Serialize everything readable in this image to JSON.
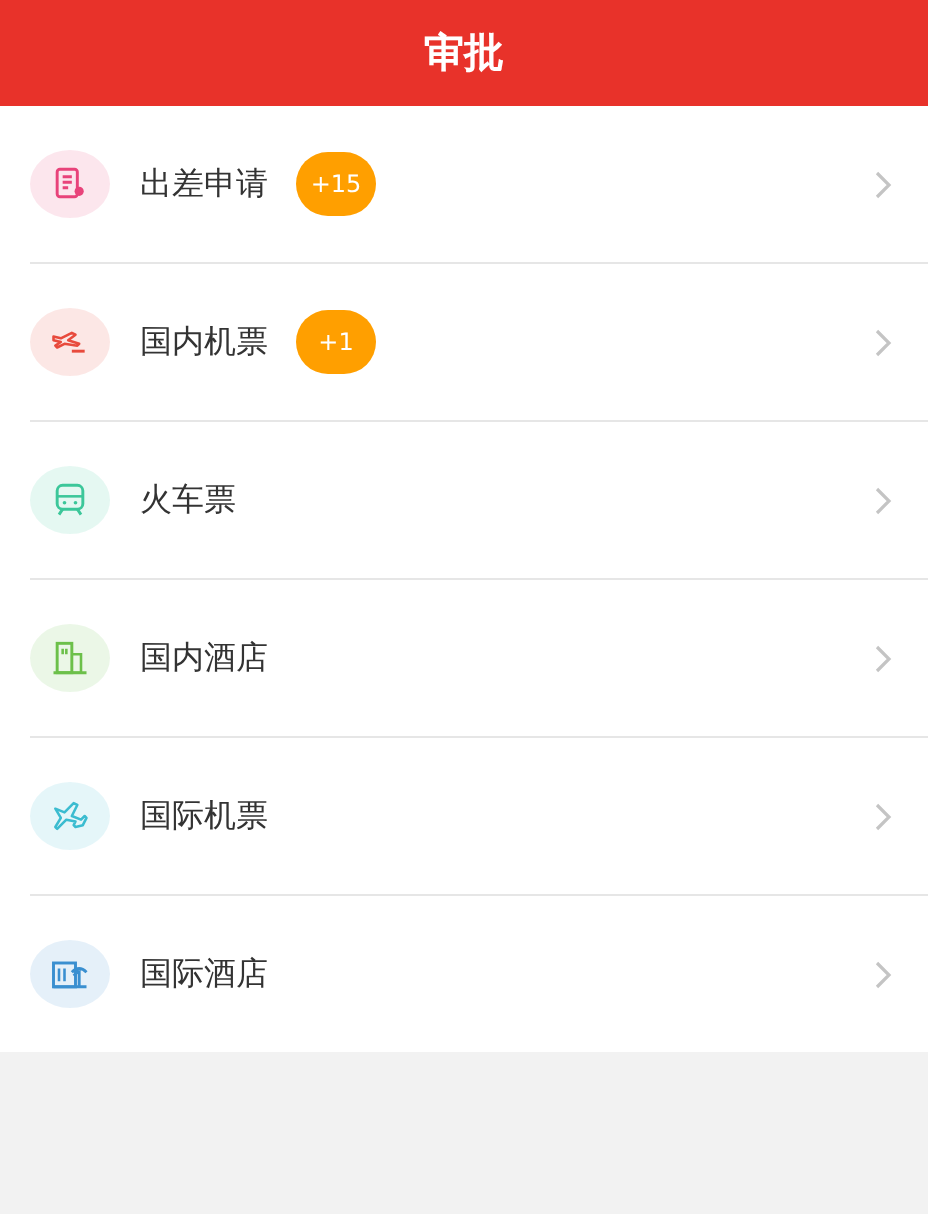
{
  "header": {
    "title": "审批"
  },
  "items": [
    {
      "kind": "document",
      "label": "出差申请",
      "badge": "+15",
      "color": "#e8437a"
    },
    {
      "kind": "plane-domestic",
      "label": "国内机票",
      "badge": "+1",
      "color": "#e84a3c"
    },
    {
      "kind": "train",
      "label": "火车票",
      "color": "#3cc79a"
    },
    {
      "kind": "building",
      "label": "国内酒店",
      "color": "#6cc04a"
    },
    {
      "kind": "plane-intl",
      "label": "国际机票",
      "color": "#3bbcd0"
    },
    {
      "kind": "resort",
      "label": "国际酒店",
      "color": "#3a8fd0"
    }
  ]
}
